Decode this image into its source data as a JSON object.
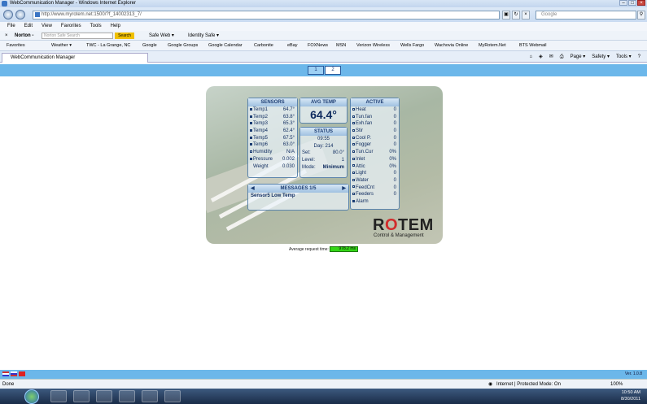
{
  "window": {
    "title": "WebCommunication Manager - Windows Internet Explorer"
  },
  "address": {
    "url": "http://www.myrotem.net:1500/?f_14002313_7/",
    "search_placeholder": "Google"
  },
  "menu": [
    "File",
    "Edit",
    "View",
    "Favorites",
    "Tools",
    "Help"
  ],
  "norton": {
    "label": "Norton -",
    "search_placeholder": "Norton Safe Search",
    "search_button": "Search",
    "safe_web": "Safe Web ▾",
    "identity_safe": "Identity Safe ▾"
  },
  "favorites": [
    "Favorites",
    "Weather ▾",
    "TWC - La Grange, NC",
    "Google",
    "Google Groups",
    "Google Calendar",
    "Carbonite",
    "eBay",
    "FOXNews",
    "MSN",
    "Verizon Wireless",
    "Wells Fargo",
    "Wachovia Online",
    "MyRotem.Net",
    "BTS Webmail"
  ],
  "tab": {
    "label": "WebCommunication Manager"
  },
  "tab_tools": [
    "Page ▾",
    "Safety ▾",
    "Tools ▾"
  ],
  "pages": [
    "1",
    "2"
  ],
  "sensors": {
    "title": "SENSORS",
    "rows": [
      {
        "label": "Temp1",
        "value": "64.7°"
      },
      {
        "label": "Temp2",
        "value": "63.8°"
      },
      {
        "label": "Temp3",
        "value": "65.3°"
      },
      {
        "label": "Temp4",
        "value": "62.4°"
      },
      {
        "label": "Temp5",
        "value": "67.5°"
      },
      {
        "label": "Temp6",
        "value": "63.0°"
      },
      {
        "label": "Humidity",
        "value": "N/A"
      },
      {
        "label": "Pressure",
        "value": "0.002"
      },
      {
        "label": "Weight",
        "value": "0.030"
      }
    ]
  },
  "avg_temp": {
    "title": "AVG TEMP",
    "value": "64.4°"
  },
  "status": {
    "title": "STATUS",
    "time": "09:55",
    "day_label": "Day:",
    "day_value": "214",
    "set_label": "Set:",
    "set_value": "80.0°",
    "level_label": "Level:",
    "level_value": "1",
    "mode_label": "Mode:",
    "mode_value": "Minimum"
  },
  "active": {
    "title": "ACTIVE",
    "rows": [
      {
        "label": "Heat",
        "value": "0"
      },
      {
        "label": "Tun.fan",
        "value": "0"
      },
      {
        "label": "Exh.fan",
        "value": "0"
      },
      {
        "label": "Stir",
        "value": "0"
      },
      {
        "label": "Cool P.",
        "value": "0"
      },
      {
        "label": "Fogger",
        "value": "0"
      },
      {
        "label": "Tun.Cur",
        "value": "0%"
      },
      {
        "label": "Inlet",
        "value": "0%"
      },
      {
        "label": "Attic",
        "value": "0%"
      },
      {
        "label": "Light",
        "value": "0"
      },
      {
        "label": "Water",
        "value": "0"
      },
      {
        "label": "FeedCnt",
        "value": "0"
      },
      {
        "label": "Feeders",
        "value": "0"
      },
      {
        "label": "Alarm",
        "value": ""
      }
    ]
  },
  "messages": {
    "title": "MESSAGES  1/5",
    "text": "Sensor5 Low Temp"
  },
  "logo": {
    "r": "R",
    "o": "O",
    "tem": "TEM",
    "sub": "Control & Management"
  },
  "request": {
    "label": "Average request time:",
    "value": "978.2 ms"
  },
  "footer": {
    "version": "Ver. 1.0.8"
  },
  "status_bar": {
    "left": "Done",
    "zone": "Internet | Protected Mode: On",
    "zoom": "100%"
  },
  "clock": {
    "time": "10:50 AM",
    "date": "8/30/2011"
  }
}
